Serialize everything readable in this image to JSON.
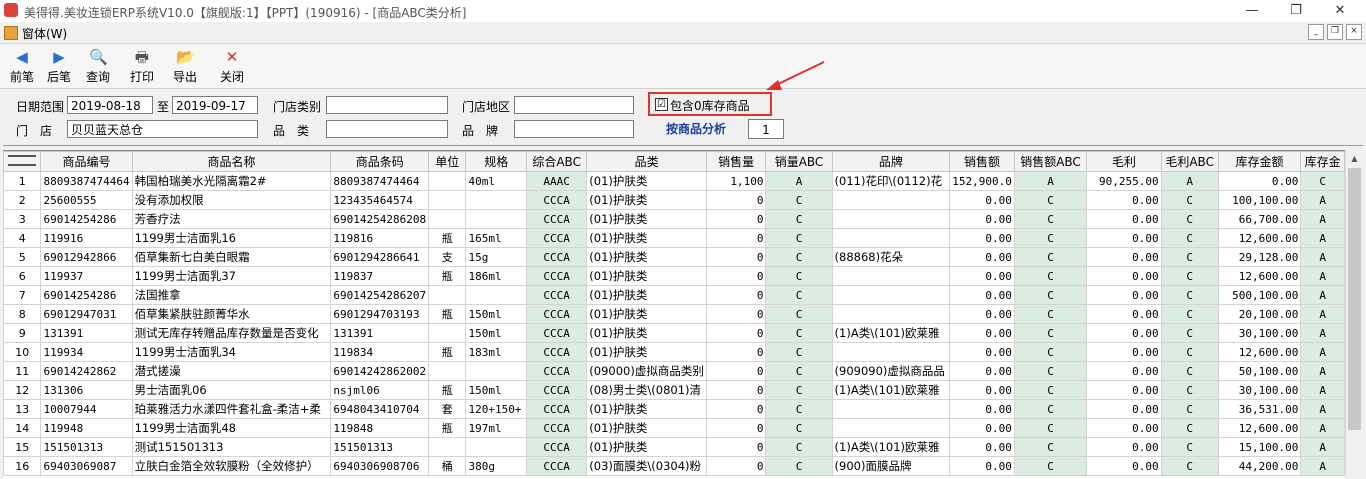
{
  "window": {
    "title": "美得得.美妆连锁ERP系统V10.0【旗舰版:1】【PPT】(190916) - [商品ABC类分析]",
    "min": "—",
    "max": "❐",
    "close": "✕"
  },
  "menu": {
    "window_label": "窗体(W)",
    "mdi_min": "_",
    "mdi_restore": "❐",
    "mdi_close": "×"
  },
  "toolbar": {
    "buttons": [
      {
        "label": "前笔",
        "icon": "arrow-left-icon",
        "glyph": "◀",
        "color": "#2a6fd6"
      },
      {
        "label": "后笔",
        "icon": "arrow-right-icon",
        "glyph": "▶",
        "color": "#2a6fd6"
      },
      {
        "label": "查询",
        "icon": "search-icon",
        "glyph": "🔍",
        "color": "#2a6fd6"
      },
      {
        "label": "打印",
        "icon": "printer-icon",
        "glyph": "🖶",
        "color": "#555555"
      },
      {
        "label": "导出",
        "icon": "export-icon",
        "glyph": "📂",
        "color": "#d08a1e"
      },
      {
        "label": "关闭",
        "icon": "close-icon",
        "glyph": "✕",
        "color": "#d93025"
      }
    ]
  },
  "filter": {
    "date_label": "日期范围",
    "date_from": "2019-08-18",
    "date_to_label": "至",
    "date_to": "2019-09-17",
    "store_type_label": "门店类别",
    "store_type": "",
    "store_region_label": "门店地区",
    "store_region": "",
    "include_zero_label": "包含0库存商品",
    "include_zero_checked": "☑",
    "store_label": "门　店",
    "store": "贝贝蓝天总仓",
    "category_label": "品　类",
    "category": "",
    "brand_label": "品　牌",
    "brand": "",
    "analyze_button": "按商品分析",
    "page_value": "1"
  },
  "colors": {
    "highlight_red": "#e03030",
    "abc_cell_bg": "#dbece0",
    "analyze_text": "#1a3fa0"
  },
  "grid": {
    "headers": [
      "商品编号",
      "商品名称",
      "商品条码",
      "单位",
      "规格",
      "综合ABC",
      "品类",
      "销售量",
      "销量ABC",
      "品牌",
      "销售额",
      "销售额ABC",
      "毛利",
      "毛利ABC",
      "库存金额",
      "库存金"
    ],
    "rows": [
      [
        "1",
        "8809387474464",
        "韩国柏瑞美水光隔离霜2#",
        "8809387474464",
        "",
        "40ml",
        "AAAC",
        "(01)护肤类",
        "1,100",
        "A",
        "(011)花印\\(0112)花",
        "152,900.0",
        "A",
        "90,255.00",
        "A",
        "0.00",
        "C"
      ],
      [
        "2",
        "25600555",
        "没有添加权限",
        "123435464574",
        "",
        "",
        "CCCA",
        "(01)护肤类",
        "0",
        "C",
        "",
        "0.00",
        "C",
        "0.00",
        "C",
        "100,100.00",
        "A"
      ],
      [
        "3",
        "69014254286",
        "芳香疗法",
        "69014254286208",
        "",
        "",
        "CCCA",
        "(01)护肤类",
        "0",
        "C",
        "",
        "0.00",
        "C",
        "0.00",
        "C",
        "66,700.00",
        "A"
      ],
      [
        "4",
        "119916",
        "1199男士洁面乳16",
        "119816",
        "瓶",
        "165ml",
        "CCCA",
        "(01)护肤类",
        "0",
        "C",
        "",
        "0.00",
        "C",
        "0.00",
        "C",
        "12,600.00",
        "A"
      ],
      [
        "5",
        "69012942866",
        "佰草集新七白美白眼霜",
        "6901294286641",
        "支",
        "15g",
        "CCCA",
        "(01)护肤类",
        "0",
        "C",
        "(88868)花朵",
        "0.00",
        "C",
        "0.00",
        "C",
        "29,128.00",
        "A"
      ],
      [
        "6",
        "119937",
        "1199男士洁面乳37",
        "119837",
        "瓶",
        "186ml",
        "CCCA",
        "(01)护肤类",
        "0",
        "C",
        "",
        "0.00",
        "C",
        "0.00",
        "C",
        "12,600.00",
        "A"
      ],
      [
        "7",
        "69014254286",
        "法国推拿",
        "69014254286207",
        "",
        "",
        "CCCA",
        "(01)护肤类",
        "0",
        "C",
        "",
        "0.00",
        "C",
        "0.00",
        "C",
        "500,100.00",
        "A"
      ],
      [
        "8",
        "69012947031",
        "佰草集紧肤驻颜菁华水",
        "6901294703193",
        "瓶",
        "150ml",
        "CCCA",
        "(01)护肤类",
        "0",
        "C",
        "",
        "0.00",
        "C",
        "0.00",
        "C",
        "20,100.00",
        "A"
      ],
      [
        "9",
        "131391",
        "测试无库存转赠品库存数量是否变化",
        "131391",
        "",
        "150ml",
        "CCCA",
        "(01)护肤类",
        "0",
        "C",
        "(1)A类\\(101)欧莱雅",
        "0.00",
        "C",
        "0.00",
        "C",
        "30,100.00",
        "A"
      ],
      [
        "10",
        "119934",
        "1199男士洁面乳34",
        "119834",
        "瓶",
        "183ml",
        "CCCA",
        "(01)护肤类",
        "0",
        "C",
        "",
        "0.00",
        "C",
        "0.00",
        "C",
        "12,600.00",
        "A"
      ],
      [
        "11",
        "69014242862",
        "潜式搓澡",
        "69014242862002",
        "",
        "",
        "CCCA",
        "(09000)虚拟商品类别",
        "0",
        "C",
        "(909090)虚拟商品品",
        "0.00",
        "C",
        "0.00",
        "C",
        "50,100.00",
        "A"
      ],
      [
        "12",
        "131306",
        "男士洁面乳06",
        "nsjml06",
        "瓶",
        "150ml",
        "CCCA",
        "(08)男士类\\(0801)清",
        "0",
        "C",
        "(1)A类\\(101)欧莱雅",
        "0.00",
        "C",
        "0.00",
        "C",
        "30,100.00",
        "A"
      ],
      [
        "13",
        "10007944",
        "珀莱雅活力水漾四件套礼盒-柔洁+柔",
        "6948043410704",
        "套",
        "120+150+",
        "CCCA",
        "(01)护肤类",
        "0",
        "C",
        "",
        "0.00",
        "C",
        "0.00",
        "C",
        "36,531.00",
        "A"
      ],
      [
        "14",
        "119948",
        "1199男士洁面乳48",
        "119848",
        "瓶",
        "197ml",
        "CCCA",
        "(01)护肤类",
        "0",
        "C",
        "",
        "0.00",
        "C",
        "0.00",
        "C",
        "12,600.00",
        "A"
      ],
      [
        "15",
        "151501313",
        "测试151501313",
        "151501313",
        "",
        "",
        "CCCA",
        "(01)护肤类",
        "0",
        "C",
        "(1)A类\\(101)欧莱雅",
        "0.00",
        "C",
        "0.00",
        "C",
        "15,100.00",
        "A"
      ],
      [
        "16",
        "69403069087",
        "立肤白金箔全效软膜粉（全效修护）",
        "6940306908706",
        "桶",
        "380g",
        "CCCA",
        "(03)面膜类\\(0304)粉",
        "0",
        "C",
        "(900)面膜品牌",
        "0.00",
        "C",
        "0.00",
        "C",
        "44,200.00",
        "A"
      ]
    ]
  }
}
